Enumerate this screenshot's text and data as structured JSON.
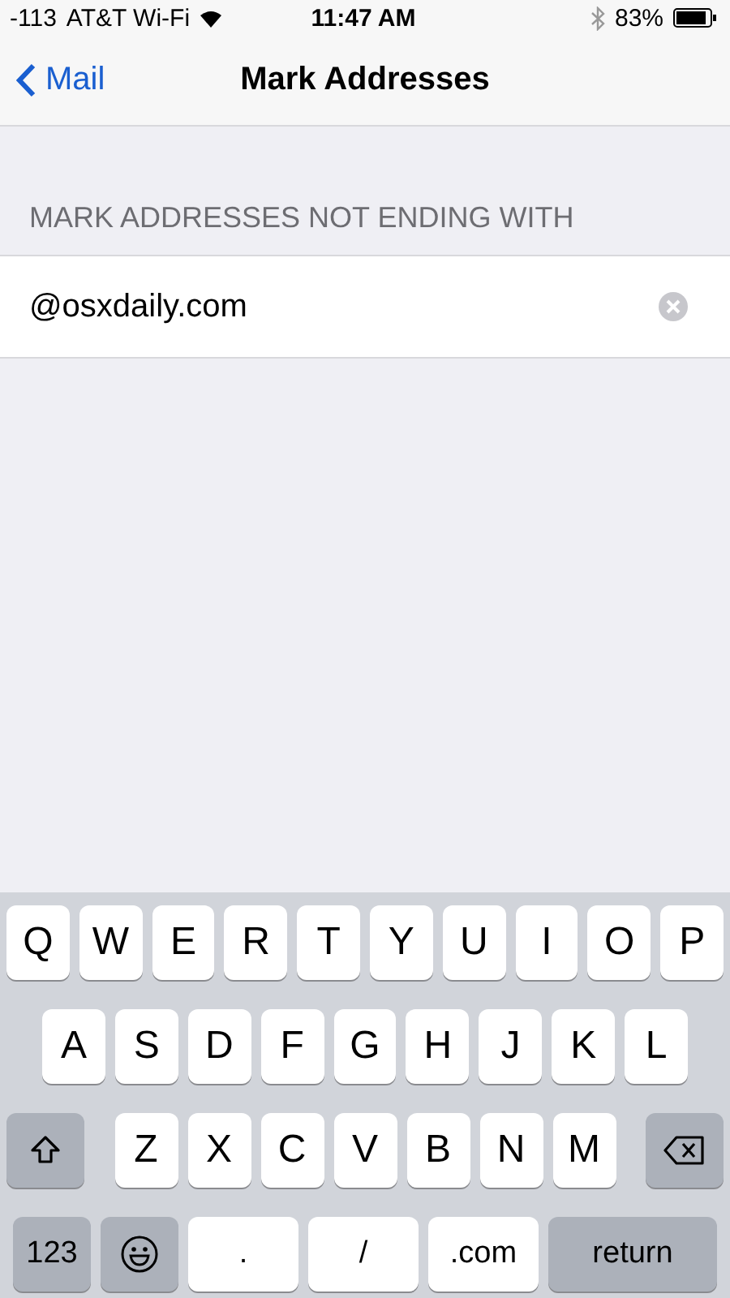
{
  "status_bar": {
    "signal": "-113",
    "carrier": "AT&T Wi-Fi",
    "time": "11:47 AM",
    "battery": "83%"
  },
  "nav": {
    "back": "Mail",
    "title": "Mark Addresses"
  },
  "section_header": "MARK ADDRESSES NOT ENDING WITH",
  "field": {
    "value": "@osxdaily.com"
  },
  "keyboard": {
    "rows": [
      {
        "keys": [
          {
            "kind": "letter",
            "label": "Q"
          },
          {
            "kind": "letter",
            "label": "W"
          },
          {
            "kind": "letter",
            "label": "E"
          },
          {
            "kind": "letter",
            "label": "R"
          },
          {
            "kind": "letter",
            "label": "T"
          },
          {
            "kind": "letter",
            "label": "Y"
          },
          {
            "kind": "letter",
            "label": "U"
          },
          {
            "kind": "letter",
            "label": "I"
          },
          {
            "kind": "letter",
            "label": "O"
          },
          {
            "kind": "letter",
            "label": "P"
          }
        ]
      },
      {
        "keys": [
          {
            "kind": "letter",
            "label": "A"
          },
          {
            "kind": "letter",
            "label": "S"
          },
          {
            "kind": "letter",
            "label": "D"
          },
          {
            "kind": "letter",
            "label": "F"
          },
          {
            "kind": "letter",
            "label": "G"
          },
          {
            "kind": "letter",
            "label": "H"
          },
          {
            "kind": "letter",
            "label": "J"
          },
          {
            "kind": "letter",
            "label": "K"
          },
          {
            "kind": "letter",
            "label": "L"
          }
        ]
      },
      {
        "keys": [
          {
            "kind": "shift"
          },
          {
            "kind": "letter",
            "label": "Z"
          },
          {
            "kind": "letter",
            "label": "X"
          },
          {
            "kind": "letter",
            "label": "C"
          },
          {
            "kind": "letter",
            "label": "V"
          },
          {
            "kind": "letter",
            "label": "B"
          },
          {
            "kind": "letter",
            "label": "N"
          },
          {
            "kind": "letter",
            "label": "M"
          },
          {
            "kind": "delete"
          }
        ]
      },
      {
        "keys": [
          {
            "kind": "numbers",
            "label": "123"
          },
          {
            "kind": "emoji"
          },
          {
            "kind": "char",
            "label": "."
          },
          {
            "kind": "char",
            "label": "/"
          },
          {
            "kind": "char",
            "label": ".com"
          },
          {
            "kind": "return",
            "label": "return"
          }
        ]
      }
    ]
  }
}
